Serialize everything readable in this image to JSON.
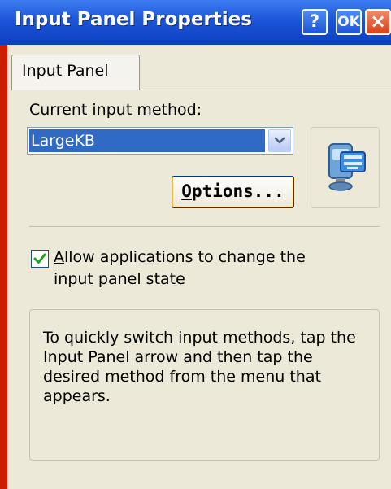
{
  "window": {
    "title": "Input Panel Properties",
    "help_label": "?",
    "ok_label": "OK",
    "close_label": "×"
  },
  "tabs": [
    {
      "label": "Input Panel",
      "selected": true
    }
  ],
  "input_method": {
    "label_pre": "Current input ",
    "label_accel": "m",
    "label_post": "ethod:",
    "selected_value": "LargeKB"
  },
  "options_button": {
    "accel": "O",
    "rest": "ptions..."
  },
  "checkbox": {
    "checked": true,
    "line1_accel": "A",
    "line1_rest": "llow applications to change the",
    "line2": "input panel state"
  },
  "info_text": "To quickly switch input methods, tap the Input Panel arrow and then tap the desired method from the menu that appears.",
  "icons": {
    "keyboard": "keyboard-computer-icon",
    "dropdown": "chevron-down-icon",
    "check": "checkmark-icon"
  },
  "colors": {
    "titlebar": "#1c55d8",
    "selection": "#316ac5",
    "check": "#21a121",
    "frame": "#cc1d00"
  }
}
